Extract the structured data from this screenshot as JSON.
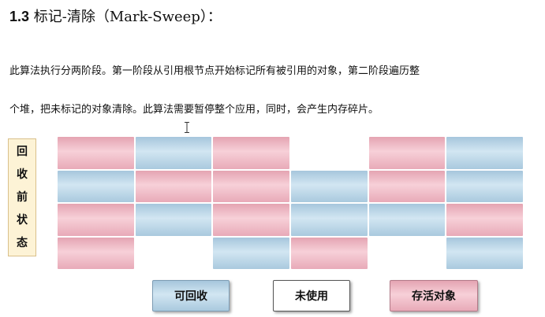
{
  "heading": {
    "number": "1.3",
    "title": "标记-清除（Mark-Sweep）："
  },
  "paragraph": {
    "line1": "此算法执行分两阶段。第一阶段从引用根节点开始标记所有被引用的对象，第二阶段遍历整",
    "line2": "个堆，把未标记的对象清除。此算法需要暂停整个应用，同时，会产生内存碎片。"
  },
  "state_label": [
    "回",
    "收",
    "前",
    "状",
    "态"
  ],
  "grid": {
    "rows": [
      [
        "alive",
        "reclaimable",
        "alive",
        "unused",
        "alive",
        "reclaimable"
      ],
      [
        "reclaimable",
        "alive",
        "alive",
        "reclaimable",
        "alive",
        "reclaimable"
      ],
      [
        "alive",
        "reclaimable",
        "alive",
        "reclaimable",
        "reclaimable",
        "alive"
      ],
      [
        "alive",
        "unused",
        "reclaimable",
        "alive",
        "unused",
        "reclaimable"
      ]
    ]
  },
  "legend": {
    "reclaimable": "可回收",
    "unused": "未使用",
    "alive": "存活对象"
  },
  "colors": {
    "alive": "#f0bcc6",
    "reclaimable": "#bcd6e8",
    "unused": "#ffffff",
    "label_bg": "#fdf3d6"
  },
  "icons": {
    "cursor": "text-cursor-icon"
  }
}
